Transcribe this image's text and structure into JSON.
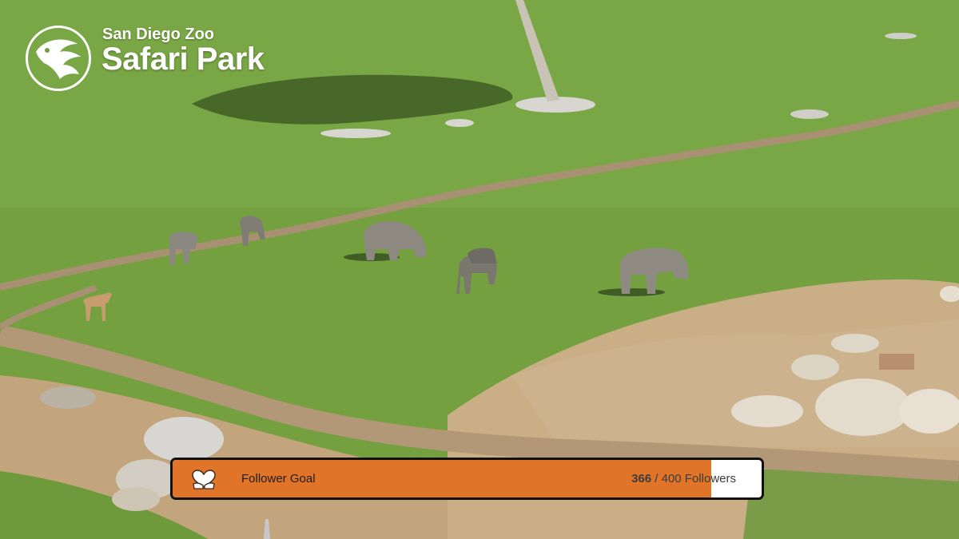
{
  "logo": {
    "line1": "San Diego Zoo",
    "line2": "Safari Park"
  },
  "scene": {
    "description_icon": "safari-webcam-scene",
    "animals": [
      "rhino",
      "rhino",
      "wildebeest",
      "wildebeest",
      "wildebeest",
      "gazelle",
      "heron"
    ]
  },
  "follower_goal": {
    "label": "Follower Goal",
    "current": "366",
    "separator": " / ",
    "target_text": "400 Followers",
    "progress_fraction": 0.915,
    "icon": "heart-hands-icon",
    "fill_color": "#e07428",
    "track_color": "#ffffff"
  }
}
